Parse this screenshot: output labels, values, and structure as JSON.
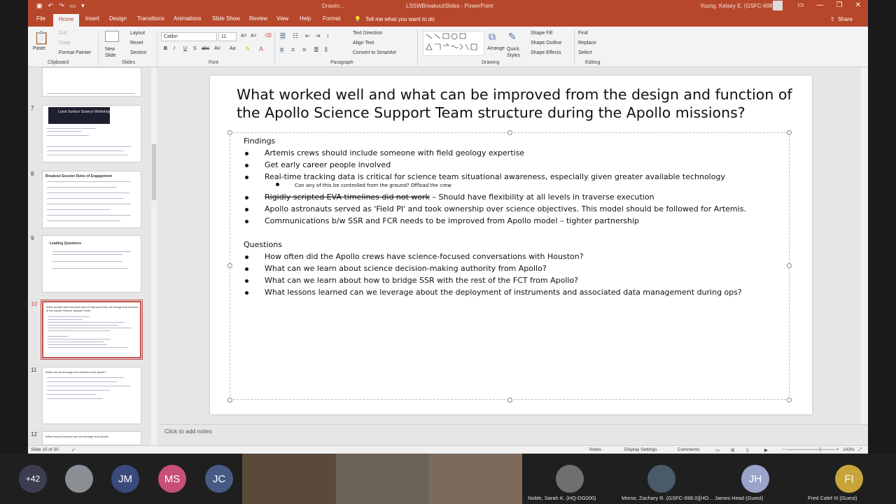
{
  "window": {
    "context_tab": "Drawin...",
    "doc_title": "LSSWBreakoutSlides - PowerPoint",
    "user": "Young, Kelsey E. (GSFC-6980)"
  },
  "tabs": [
    "File",
    "Home",
    "Insert",
    "Design",
    "Transitions",
    "Animations",
    "Slide Show",
    "Review",
    "View",
    "Help",
    "Format"
  ],
  "active_tab": "Home",
  "tell_me": "Tell me what you want to do",
  "share_label": "Share",
  "ribbon": {
    "clipboard": {
      "paste": "Paste",
      "cut": "Cut",
      "copy": "Copy",
      "format_painter": "Format Painter",
      "label": "Clipboard"
    },
    "slides": {
      "new_slide": "New Slide",
      "layout": "Layout",
      "reset": "Reset",
      "section": "Section",
      "label": "Slides"
    },
    "font": {
      "name": "Calibri",
      "size": "11",
      "bold": "B",
      "italic": "I",
      "underline": "U",
      "strike": "S",
      "shadow": "abc",
      "spacing": "AV",
      "case": "Aa",
      "label": "Font"
    },
    "paragraph": {
      "text_direction": "Text Direction",
      "align_text": "Align Text",
      "convert_smartart": "Convert to SmartArt",
      "label": "Paragraph"
    },
    "drawing": {
      "arrange": "Arrange",
      "quick_styles": "Quick Styles",
      "shape_fill": "Shape Fill",
      "shape_outline": "Shape Outline",
      "shape_effects": "Shape Effects",
      "label": "Drawing"
    },
    "editing": {
      "find": "Find",
      "replace": "Replace",
      "select": "Select",
      "label": "Editing"
    }
  },
  "thumbnails": [
    {
      "num": "7",
      "title": "Lunar Surface Science Workshop"
    },
    {
      "num": "8",
      "title": "Breakout Session Rules of Engagement"
    },
    {
      "num": "9",
      "title": "Leading Questions"
    },
    {
      "num": "10",
      "title": "What worked well and what can be improved from the design and function of the Apollo Science Support Team"
    },
    {
      "num": "11",
      "title": "What can we leverage from Artemis from Apollo?"
    },
    {
      "num": "12",
      "title": "What lessons learned can we leverage from Apollo"
    }
  ],
  "slide": {
    "title": "What worked well and what can be improved from the design and function of the Apollo Science Support Team structure during the Apollo missions?",
    "findings_header": "Findings",
    "findings": [
      "Artemis crews should include someone with field geology expertise",
      "Get early career people involved",
      "Real-time tracking data is critical for science team situational awareness, especially given greater available technology",
      "Rigidly scripted EVA timelines did not work – Should have flexibility at all levels in traverse execution",
      "Apollo astronauts served as 'Field PI' and took ownership over science objectives. This model should be followed for Artemis.",
      "Communications b/w SSR and FCR needs to be improved from Apollo model – tighter partnership"
    ],
    "subnote": "Can any of this be controlled from the ground? Offload the crew",
    "struck_text": "Rigidly scripted EVA timelines did not work",
    "rest_text": " – Should have flexibility at all levels in traverse execution",
    "questions_header": "Questions",
    "questions": [
      "How often did the Apollo crews have science-focused conversations with Houston?",
      "What can we learn about science decision-making authority from Apollo?",
      "What can we learn about how to bridge SSR with the rest of the FCT from Apollo?",
      "What lessons learned can we leverage about the deployment of instruments and associated data management during ops?"
    ]
  },
  "notes_placeholder": "Click to add notes",
  "status": {
    "slide_of": "Slide 10 of 30",
    "notes": "Notes",
    "display_settings": "Display Settings",
    "comments": "Comments",
    "zoom": "143%"
  },
  "participants": {
    "overflow": "+42",
    "initials": [
      {
        "text": "JM",
        "color": "#3b4a7c"
      },
      {
        "text": "MS",
        "color": "#c84f78"
      },
      {
        "text": "JC",
        "color": "#465a84"
      },
      {
        "text": "JH",
        "color": "#9aa3c9"
      },
      {
        "text": "FI",
        "color": "#c9a43b"
      }
    ],
    "names": [
      "Noble, Sarah K. (HQ-DG000)",
      "Morse, Zachary R. (GSFC-698.0)[HO...",
      "James Head (Guest)",
      "Fred Calef III (Guest)"
    ]
  }
}
